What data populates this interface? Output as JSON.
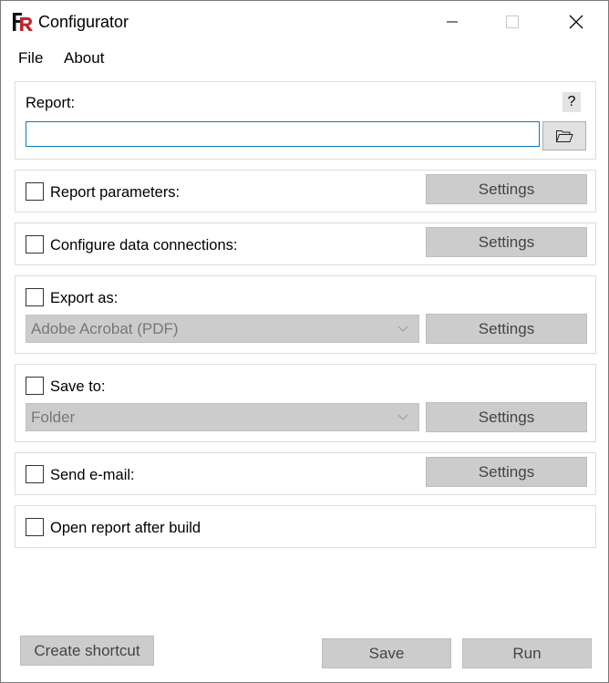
{
  "window": {
    "title": "Configurator"
  },
  "menu": {
    "file": "File",
    "about": "About"
  },
  "report": {
    "label": "Report:",
    "help": "?",
    "path_value": ""
  },
  "report_parameters": {
    "label": "Report parameters:",
    "settings": "Settings"
  },
  "data_connections": {
    "label": "Configure data connections:",
    "settings": "Settings"
  },
  "export": {
    "label": "Export as:",
    "selected": "Adobe Acrobat (PDF)",
    "settings": "Settings"
  },
  "save_to": {
    "label": "Save to:",
    "selected": "Folder",
    "settings": "Settings"
  },
  "send_email": {
    "label": "Send e-mail:",
    "settings": "Settings"
  },
  "open_after": {
    "label": "Open report after build"
  },
  "footer": {
    "create_shortcut": "Create shortcut",
    "save": "Save",
    "run": "Run"
  },
  "colors": {
    "logo_red": "#c0282d",
    "logo_black": "#111111",
    "disabled_button": "#cccccc",
    "input_border": "#0c7ab8"
  },
  "icons": {
    "logo": "fastreport-logo-icon",
    "folder": "folder-open-icon",
    "minimize": "minimize-icon",
    "maximize": "maximize-icon",
    "close": "close-icon",
    "dropdown": "chevron-down-icon"
  }
}
